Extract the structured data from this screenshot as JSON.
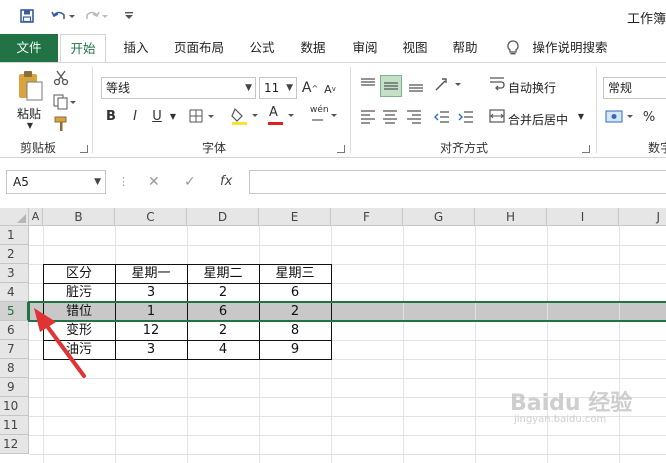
{
  "window": {
    "title": "工作簿"
  },
  "quick_access": {
    "save_icon": "save-icon",
    "undo_icon": "undo-icon",
    "redo_icon": "redo-icon",
    "customize_icon": "customize-icon"
  },
  "tabs": [
    "文件",
    "开始",
    "插入",
    "页面布局",
    "公式",
    "数据",
    "审阅",
    "视图",
    "帮助"
  ],
  "tell_me": "操作说明搜索",
  "ribbon": {
    "clipboard": {
      "paste_label": "粘贴",
      "group_label": "剪贴板"
    },
    "font": {
      "font_name": "等线",
      "font_size": "11",
      "bold": "B",
      "italic": "I",
      "underline": "U",
      "font_color_glyph": "A",
      "phonetic_glyph": "wén",
      "group_label": "字体"
    },
    "alignment": {
      "wrap_text": "自动换行",
      "merge_center": "合并后居中",
      "group_label": "对齐方式"
    },
    "number": {
      "format": "常规",
      "percent": "%",
      "group_label": "数字"
    }
  },
  "formula_bar": {
    "name_box": "A5",
    "fx": "fx",
    "value": ""
  },
  "columns": [
    "A",
    "B",
    "C",
    "D",
    "E",
    "F",
    "G",
    "H",
    "I",
    "J"
  ],
  "rows": [
    "1",
    "2",
    "3",
    "4",
    "5",
    "6",
    "7",
    "8",
    "9",
    "10",
    "11",
    "12"
  ],
  "selected_row": "5",
  "table": {
    "headers": [
      "区分",
      "星期一",
      "星期二",
      "星期三"
    ],
    "rows": [
      [
        "脏污",
        "3",
        "2",
        "6"
      ],
      [
        "错位",
        "1",
        "6",
        "2"
      ],
      [
        "变形",
        "12",
        "2",
        "8"
      ],
      [
        "油污",
        "3",
        "4",
        "9"
      ]
    ]
  },
  "watermark": {
    "text": "Baidu 经验",
    "sub": "jingyan.baidu.com"
  },
  "colors": {
    "accent": "#217346",
    "arrow": "#e03434",
    "selected_row": "#c8c8c8"
  }
}
